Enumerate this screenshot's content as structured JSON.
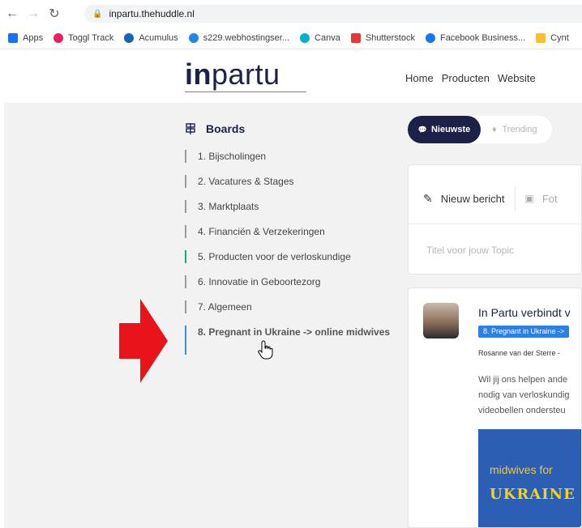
{
  "browser": {
    "url": "inpartu.thehuddle.nl",
    "bookmarks": [
      {
        "label": "Apps",
        "color": "#1a73e8"
      },
      {
        "label": "Toggl Track",
        "color": "#e91e63"
      },
      {
        "label": "Acumulus",
        "color": "#1565c0"
      },
      {
        "label": "s229.webhostingser...",
        "color": "#1e88e5"
      },
      {
        "label": "Canva",
        "color": "#00b2ca"
      },
      {
        "label": "Shutterstock",
        "color": "#e53935"
      },
      {
        "label": "Facebook Business...",
        "color": "#1877f2"
      },
      {
        "label": "Cynt",
        "color": "#fbc02d"
      }
    ]
  },
  "site": {
    "logo_bold": "in",
    "logo_light": "partu",
    "nav": [
      "Home",
      "Producten",
      "Website"
    ]
  },
  "sidebar": {
    "title": "Boards",
    "items": [
      {
        "label": "1. Bijscholingen"
      },
      {
        "label": "2. Vacatures & Stages"
      },
      {
        "label": "3. Marktplaats"
      },
      {
        "label": "4. Financiën & Verzekeringen"
      },
      {
        "label": "5. Producten voor de verloskundige"
      },
      {
        "label": "6. Innovatie in Geboortezorg"
      },
      {
        "label": "7. Algemeen"
      },
      {
        "label": "8. Pregnant in Ukraine -> online midwives"
      }
    ]
  },
  "feed": {
    "tabs": {
      "newest": "Nieuwste",
      "trending": "Trending"
    },
    "composer": {
      "new_post": "Nieuw bericht",
      "photo": "Fot",
      "title_placeholder": "Titel voor jouw Topic"
    },
    "topic": {
      "title": "In Partu verbindt v",
      "badge": "8. Pregnant in Ukraine ->",
      "author": "Rosanne van der Sterre -",
      "body": [
        "Wil jij ons helpen ande",
        "nodig van verloskundig",
        "videobellen ondersteu"
      ],
      "image_line1": "midwives for",
      "image_line2": "UKRAINE"
    }
  },
  "colors": {
    "brand_navy": "#1b2147",
    "active_board": "#3a8fd9",
    "green_marker": "#2aa17b",
    "arrow_red": "#e8141a"
  }
}
